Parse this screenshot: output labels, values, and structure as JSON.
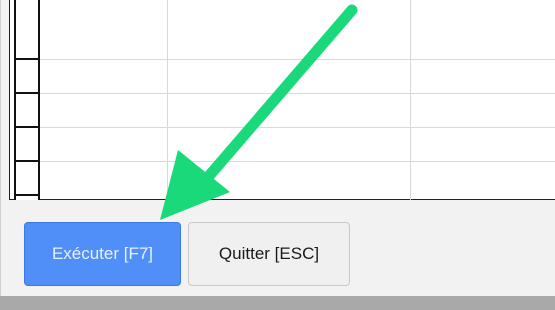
{
  "buttons": {
    "execute_label": "Exécuter [F7]",
    "quit_label": "Quitter [ESC]"
  },
  "colors": {
    "execute_bg": "#4f8ff7",
    "quit_bg": "#f0f0f0",
    "arrow": "#19d97a"
  },
  "annotation": {
    "icon": "arrow-pointer-icon"
  }
}
